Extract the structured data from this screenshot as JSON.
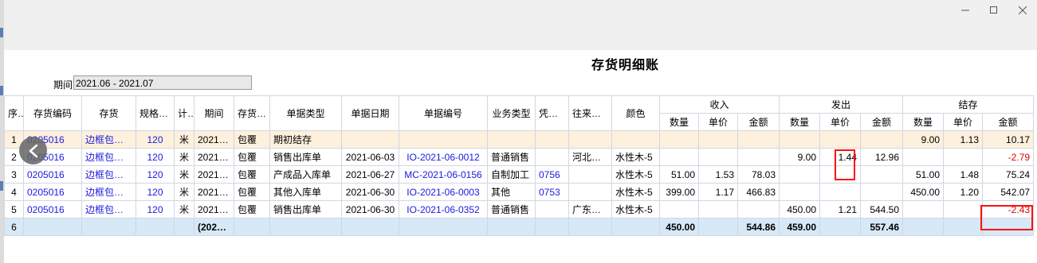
{
  "window": {
    "controls": {
      "minimize": "—",
      "maximize": "☐",
      "close": "✕"
    }
  },
  "report": {
    "title": "存货明细账",
    "period_label": "期间",
    "period_value": "2021.06 - 2021.07"
  },
  "table": {
    "headers": {
      "seq": "序号",
      "code": "存货编码",
      "name": "存货",
      "spec": "规格型号",
      "unit": "计…",
      "period": "期间",
      "category": "存货…",
      "doc_type": "单据类型",
      "doc_date": "单据日期",
      "doc_no": "单据编号",
      "biz_type": "业务类型",
      "voucher": "凭证号",
      "partner": "往来单位",
      "color": "颜色",
      "in_group": "收入",
      "out_group": "发出",
      "bal_group": "结存",
      "in_qty": "数量",
      "in_price": "单价",
      "in_amt": "金额",
      "out_qty": "数量",
      "out_price": "单价",
      "out_amt": "金额",
      "bal_qty": "数量",
      "bal_price": "单价",
      "bal_amt": "金额"
    },
    "rows": [
      {
        "seq": "1",
        "code": "0205016",
        "name": "边框包覆…",
        "spec": "120",
        "unit": "米",
        "period": "2021…",
        "category": "包覆",
        "doc_type": "期初结存",
        "doc_date": "",
        "doc_no": "",
        "biz_type": "",
        "voucher": "",
        "partner": "",
        "color": "",
        "in_qty": "",
        "in_price": "",
        "in_amt": "",
        "out_qty": "",
        "out_price": "",
        "out_amt": "",
        "bal_qty": "9.00",
        "bal_price": "1.13",
        "bal_amt": "10.17"
      },
      {
        "seq": "2",
        "code": "0205016",
        "name": "边框包覆…",
        "spec": "120",
        "unit": "米",
        "period": "2021…",
        "category": "包覆",
        "doc_type": "销售出库单",
        "doc_date": "2021-06-03",
        "doc_no": "IO-2021-06-0012",
        "biz_type": "普通销售",
        "voucher": "",
        "partner": "河北…",
        "color": "水性木-5",
        "in_qty": "",
        "in_price": "",
        "in_amt": "",
        "out_qty": "9.00",
        "out_price": "1.44",
        "out_amt": "12.96",
        "bal_qty": "",
        "bal_price": "",
        "bal_amt": "-2.79"
      },
      {
        "seq": "3",
        "code": "0205016",
        "name": "边框包覆…",
        "spec": "120",
        "unit": "米",
        "period": "2021…",
        "category": "包覆",
        "doc_type": "产成品入库单",
        "doc_date": "2021-06-27",
        "doc_no": "MC-2021-06-0156",
        "biz_type": "自制加工",
        "voucher": "0756",
        "partner": "",
        "color": "水性木-5",
        "in_qty": "51.00",
        "in_price": "1.53",
        "in_amt": "78.03",
        "out_qty": "",
        "out_price": "",
        "out_amt": "",
        "bal_qty": "51.00",
        "bal_price": "1.48",
        "bal_amt": "75.24"
      },
      {
        "seq": "4",
        "code": "0205016",
        "name": "边框包覆…",
        "spec": "120",
        "unit": "米",
        "period": "2021…",
        "category": "包覆",
        "doc_type": "其他入库单",
        "doc_date": "2021-06-30",
        "doc_no": "IO-2021-06-0003",
        "biz_type": "其他",
        "voucher": "0753",
        "partner": "",
        "color": "水性木-5",
        "in_qty": "399.00",
        "in_price": "1.17",
        "in_amt": "466.83",
        "out_qty": "",
        "out_price": "",
        "out_amt": "",
        "bal_qty": "450.00",
        "bal_price": "1.20",
        "bal_amt": "542.07"
      },
      {
        "seq": "5",
        "code": "0205016",
        "name": "边框包覆…",
        "spec": "120",
        "unit": "米",
        "period": "2021…",
        "category": "包覆",
        "doc_type": "销售出库单",
        "doc_date": "2021-06-30",
        "doc_no": "IO-2021-06-0352",
        "biz_type": "普通销售",
        "voucher": "",
        "partner": "广东…",
        "color": "水性木-5",
        "in_qty": "",
        "in_price": "",
        "in_amt": "",
        "out_qty": "450.00",
        "out_price": "1.21",
        "out_amt": "544.50",
        "bal_qty": "",
        "bal_price": "",
        "bal_amt": "-2.43"
      }
    ],
    "total_row": {
      "seq": "6",
      "period": "(202…",
      "in_qty": "450.00",
      "in_amt": "544.86",
      "out_qty": "459.00",
      "out_amt": "557.46"
    }
  },
  "colors": {
    "link_blue": "#1a1adf",
    "negative_red": "#e00000",
    "opening_row_bg": "#fdf0dc",
    "total_row_bg": "#d7e8f7",
    "highlight_box": "#ff1010"
  },
  "icons": [
    "minimize-icon",
    "maximize-icon",
    "close-icon",
    "chevron-left-icon"
  ]
}
